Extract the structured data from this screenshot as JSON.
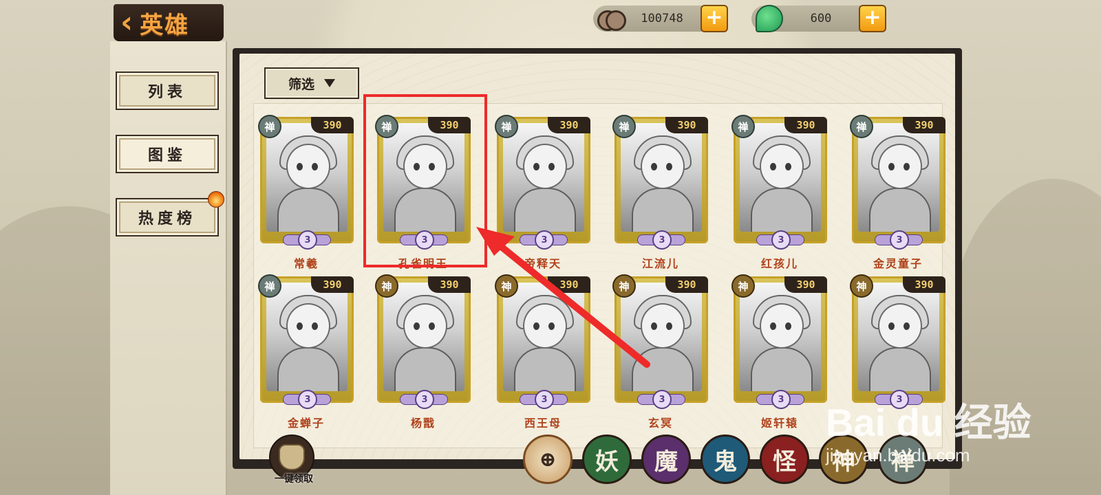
{
  "header": {
    "title": "英雄",
    "currency": [
      {
        "icon": "copper-coin-icon",
        "value": "100748"
      },
      {
        "icon": "jade-icon",
        "value": "600"
      }
    ]
  },
  "sidebar": {
    "items": [
      {
        "label": "列表",
        "active": false
      },
      {
        "label": "图鉴",
        "active": true
      },
      {
        "label": "热度榜",
        "active": false,
        "badge": "hot-flame-icon"
      }
    ]
  },
  "filter": {
    "label": "筛选"
  },
  "heroes": [
    {
      "name": "常羲",
      "faction": "禅",
      "power": "390",
      "star": "3"
    },
    {
      "name": "孔雀明王",
      "faction": "禅",
      "power": "390",
      "star": "3",
      "highlighted": true
    },
    {
      "name": "帝释天",
      "faction": "禅",
      "power": "390",
      "star": "3"
    },
    {
      "name": "江流儿",
      "faction": "禅",
      "power": "390",
      "star": "3"
    },
    {
      "name": "红孩儿",
      "faction": "禅",
      "power": "390",
      "star": "3"
    },
    {
      "name": "金灵童子",
      "faction": "禅",
      "power": "390",
      "star": "3"
    },
    {
      "name": "金蝉子",
      "faction": "禅",
      "power": "390",
      "star": "3"
    },
    {
      "name": "杨戬",
      "faction": "神",
      "power": "390",
      "star": "3"
    },
    {
      "name": "西王母",
      "faction": "神",
      "power": "390",
      "star": "3"
    },
    {
      "name": "玄冥",
      "faction": "神",
      "power": "390",
      "star": "3"
    },
    {
      "name": "姬轩辕",
      "faction": "神",
      "power": "390",
      "star": "3"
    },
    {
      "name": "",
      "faction": "神",
      "power": "390",
      "star": "3"
    }
  ],
  "bottom": {
    "claim_all": "一键领取",
    "tabs": [
      {
        "label": "",
        "icon": "all-factions-icon",
        "color": "#c99a60",
        "active": true
      },
      {
        "label": "妖",
        "color": "#2f6b3a"
      },
      {
        "label": "魔",
        "color": "#5a2f6b"
      },
      {
        "label": "鬼",
        "color": "#1f5a78"
      },
      {
        "label": "怪",
        "color": "#8a2020"
      },
      {
        "label": "神",
        "color": "#8a6a2c"
      },
      {
        "label": "禅",
        "color": "#6b7c76"
      }
    ]
  },
  "watermark": {
    "logo": "Bai du 经验",
    "url": "jingyan.baidu.com"
  }
}
